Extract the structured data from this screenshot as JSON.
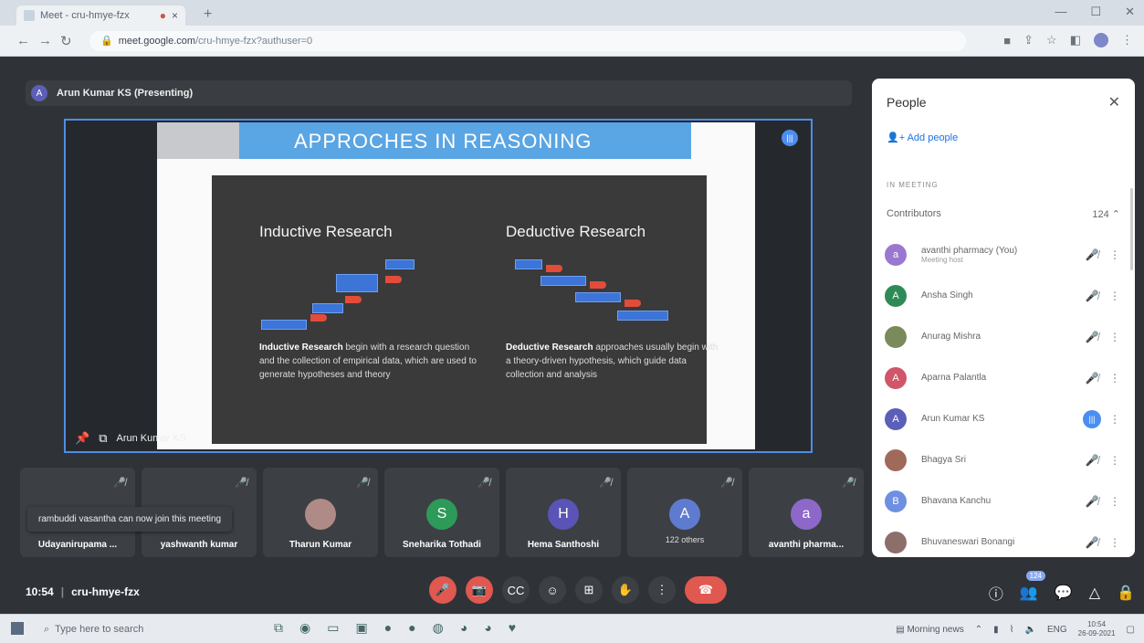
{
  "browser": {
    "tab_title": "Meet - cru-hmye-fzx",
    "tab_close": "×",
    "new_tab": "+",
    "url_host": "meet.google.com",
    "url_path": "/cru-hmye-fzx?authuser=0",
    "window_controls": [
      "—",
      "☐",
      "✕"
    ]
  },
  "presenter": {
    "avatar": "A",
    "label": "Arun Kumar KS (Presenting)"
  },
  "slide": {
    "title": "APPROCHES IN REASONING",
    "left": {
      "heading": "Inductive Research",
      "bold": "Inductive Research",
      "text": " begin with a research question and the collection of empirical data, which are used to generate hypotheses and theory"
    },
    "right": {
      "heading": "Deductive Research",
      "bold": "Deductive Research",
      "text": " approaches usually begin with a theory-driven hypothesis, which guide data collection and analysis"
    }
  },
  "stage_footer_name": "Arun Kumar KS",
  "tiles": [
    {
      "name": "Udayanirupama ...",
      "avatar": "",
      "color": "#3c4045"
    },
    {
      "name": "yashwanth kumar",
      "avatar": "",
      "color": "#3c4045"
    },
    {
      "name": "Tharun Kumar",
      "avatar": "",
      "color": "#b08a86"
    },
    {
      "name": "Sneharika Tothadi",
      "avatar": "S",
      "color": "#2e9a5a"
    },
    {
      "name": "Hema Santhoshi",
      "avatar": "H",
      "color": "#5954b5"
    },
    {
      "name": "",
      "avatar": "A",
      "color": "#5f7bd0",
      "others": "122 others"
    },
    {
      "name": "avanthi pharma...",
      "avatar": "a",
      "color": "#8d68c8"
    }
  ],
  "toast": "rambuddi vasantha can now join this meeting",
  "meeting": {
    "time": "10:54",
    "code": "cru-hmye-fzx"
  },
  "participant_count": "124",
  "panel": {
    "title": "People",
    "add_people": "Add people",
    "in_meeting": "IN MEETING",
    "contributors": "Contributors",
    "contributors_count": "124",
    "people": [
      {
        "name": "avanthi pharmacy (You)",
        "sub": "Meeting host",
        "avatar": "a",
        "color": "#9b78d0",
        "speaking": false
      },
      {
        "name": "Ansha Singh",
        "sub": "",
        "avatar": "A",
        "color": "#2e8b57",
        "speaking": false
      },
      {
        "name": "Anurag Mishra",
        "sub": "",
        "avatar": "",
        "color": "#7a8a5a",
        "speaking": false
      },
      {
        "name": "Aparna Palantla",
        "sub": "",
        "avatar": "A",
        "color": "#d0566a",
        "speaking": false
      },
      {
        "name": "Arun Kumar KS",
        "sub": "",
        "avatar": "A",
        "color": "#5c5fb7",
        "speaking": true
      },
      {
        "name": "Bhagya Sri",
        "sub": "",
        "avatar": "",
        "color": "#a06a5a",
        "speaking": false
      },
      {
        "name": "Bhavana Kanchu",
        "sub": "",
        "avatar": "B",
        "color": "#6f8fe0",
        "speaking": false
      },
      {
        "name": "Bhuvaneswari Bonangi",
        "sub": "",
        "avatar": "",
        "color": "#8c6e6a",
        "speaking": false
      }
    ]
  },
  "taskbar": {
    "search_placeholder": "Type here to search",
    "news": "Morning news",
    "lang": "ENG",
    "time": "10:54",
    "date": "26-09-2021"
  }
}
